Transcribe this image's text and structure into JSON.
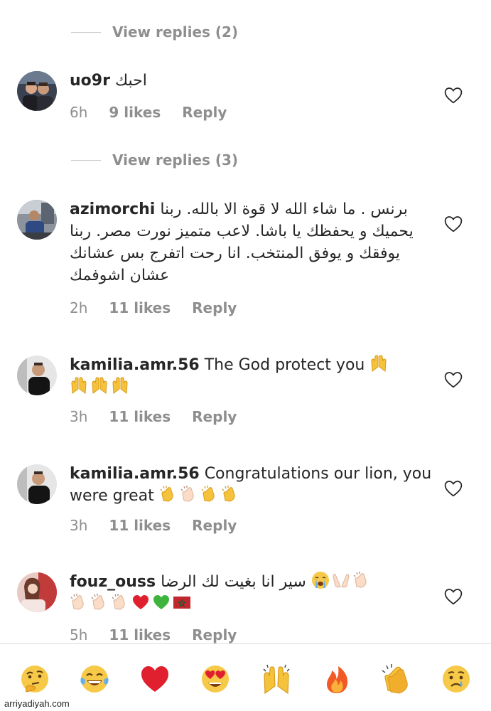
{
  "view_replies_1": "View replies (2)",
  "view_replies_2": "View replies (3)",
  "comments": [
    {
      "username": "uo9r",
      "text": "احبك",
      "time": "6h",
      "likes": "9 likes",
      "reply": "Reply"
    },
    {
      "username": "azimorchi",
      "text": "برنس . ما شاء الله لا قوة الا بالله.  ربنا يحميك و يحفظك يا باشا.  لاعب متميز نورت مصر. ربنا يوفقك و يوفق المنتخب. انا رحت اتفرج بس عشانك عشان اشوفمك",
      "time": "2h",
      "likes": "11 likes",
      "reply": "Reply"
    },
    {
      "username": "kamilia.amr.56",
      "text": "The God protect you",
      "emojis": [
        "raised-hands-icon",
        "raised-hands-icon",
        "raised-hands-icon",
        "raised-hands-icon"
      ],
      "time": "3h",
      "likes": "11 likes",
      "reply": "Reply"
    },
    {
      "username": "kamilia.amr.56",
      "text": "Congratulations our lion, you were great",
      "emojis": [
        "clapping-hands-icon",
        "clapping-hands-icon",
        "clapping-hands-icon",
        "clapping-hands-icon"
      ],
      "time": "3h",
      "likes": "11 likes",
      "reply": "Reply"
    },
    {
      "username": "fouz_ouss",
      "text": "سير انا بغيت لك الرضا",
      "emojis": [
        "loudly-crying-face-icon",
        "palms-up-icon",
        "clapping-hands-icon",
        "clapping-hands-icon",
        "clapping-hands-icon",
        "clapping-hands-icon",
        "red-heart-icon",
        "green-heart-icon",
        "morocco-flag-icon"
      ],
      "time": "5h",
      "likes": "11 likes",
      "reply": "Reply"
    }
  ],
  "emoji_bar": [
    "thinking-face-icon",
    "tears-of-joy-icon",
    "red-heart-icon",
    "heart-eyes-icon",
    "raised-hands-icon",
    "fire-icon",
    "clapping-hands-icon",
    "crying-face-icon"
  ],
  "watermark": "arriyadiyah.com",
  "colors": {
    "text": "#262626",
    "secondary": "#8e8e8e",
    "divider": "#c7c7c7"
  }
}
